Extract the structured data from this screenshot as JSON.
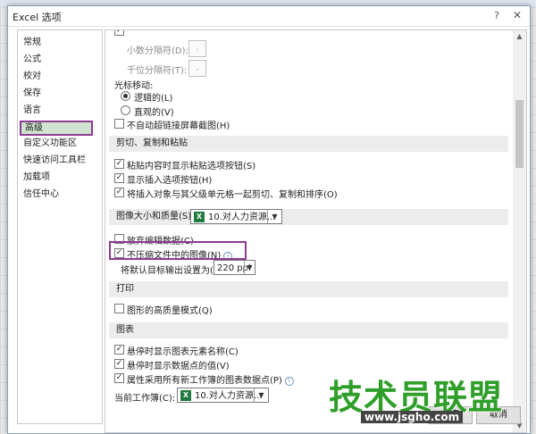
{
  "dialog": {
    "title": "Excel 选项",
    "help_glyph": "?",
    "close_glyph": "✕"
  },
  "sidebar": {
    "items": [
      {
        "label": "常规",
        "selected": false
      },
      {
        "label": "公式",
        "selected": false
      },
      {
        "label": "校对",
        "selected": false
      },
      {
        "label": "保存",
        "selected": false
      },
      {
        "label": "语言",
        "selected": false
      },
      {
        "label": "高级",
        "selected": true
      },
      {
        "label": "自定义功能区",
        "selected": false
      },
      {
        "label": "快速访问工具栏",
        "selected": false
      },
      {
        "label": "加载项",
        "selected": false
      },
      {
        "label": "信任中心",
        "selected": false
      }
    ]
  },
  "editing": {
    "decimal_separator_label": "小数分隔符(D):",
    "decimal_separator_value": ".",
    "thousands_separator_label": "千位分隔符(T):",
    "thousands_separator_value": ",",
    "cursor_movement_label": "光标移动:",
    "logical_label": "逻辑的(L)",
    "logical_checked": true,
    "visual_label": "直观的(V)",
    "visual_checked": false,
    "no_autoscroll_label": "不自动超链接屏幕截图(H)",
    "no_autoscroll_checked": false
  },
  "cut_copy_paste": {
    "heading": "剪切、复制和粘贴",
    "paste_options_label": "粘贴内容时显示粘贴选项按钮(S)",
    "paste_options_checked": true,
    "insert_options_label": "显示插入选项按钮(H)",
    "insert_options_checked": true,
    "cut_copy_sort_label": "将插入对象与其父级单元格一起剪切、复制和排序(O)",
    "cut_copy_sort_checked": true
  },
  "image_size_quality": {
    "heading": "图像大小和质量(S)",
    "workbook_value": "10.对人力资源...",
    "discard_editing_label": "放弃编辑数据(C)",
    "discard_editing_checked": false,
    "no_compress_label": "不压缩文件中的图像(N)",
    "no_compress_checked": true,
    "default_output_label": "将默认目标输出设置为(P):",
    "default_output_value": "220 ppi"
  },
  "print": {
    "heading": "打印",
    "high_quality_label": "图形的高质量模式(Q)",
    "high_quality_checked": false
  },
  "chart": {
    "heading": "图表",
    "show_element_names_label": "悬停时显示图表元素名称(C)",
    "show_element_names_checked": true,
    "show_data_point_values_label": "悬停时显示数据点的值(V)",
    "show_data_point_values_checked": true,
    "properties_follow_label": "属性采用所有新工作簿的图表数据点(P)",
    "properties_follow_checked": true,
    "current_workbook_label": "当前工作簿(C):",
    "current_workbook_value": "10.对人力资源..."
  },
  "footer": {
    "ok_label": "确定",
    "cancel_label": "取消"
  },
  "watermark": {
    "brand": "技术员联盟",
    "url": "www.jsgho.com"
  },
  "colors": {
    "highlight_border": "#8d3a94",
    "selected_bg": "#cfe4cf",
    "excel_green": "#1f7a3f",
    "watermark_green": "#2f9f2a"
  }
}
